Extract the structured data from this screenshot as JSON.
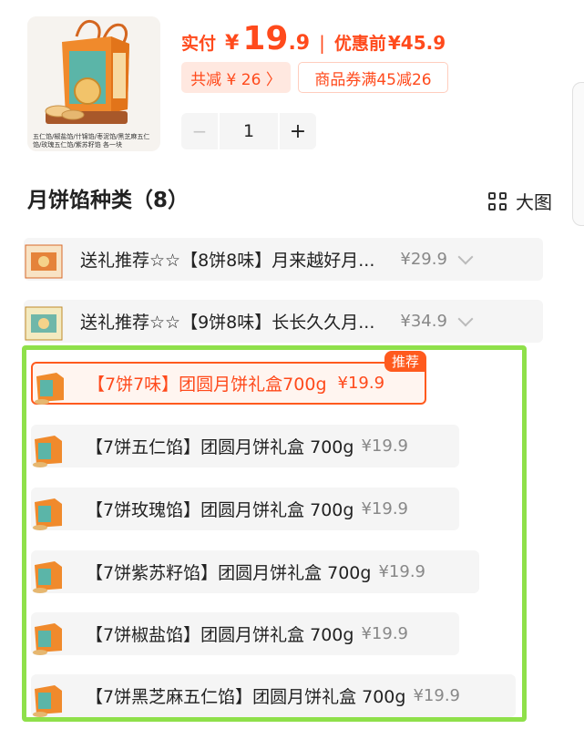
{
  "product": {
    "caption": "五仁馅/椒盐馅/什锦馅/枣泥馅/黑芝麻五仁馅/玫瑰五仁馅/紫苏籽馅 各一块"
  },
  "price": {
    "label": "实付",
    "currency": "¥",
    "int": "19",
    "dec": ".9",
    "separator": "|",
    "original_label": "优惠前",
    "original": "¥45.9"
  },
  "discounts": {
    "total_label": "共减 ¥ 26 〉",
    "coupon_label": "商品券满45减26"
  },
  "stepper": {
    "minus": "−",
    "qty": "1",
    "plus": "+"
  },
  "section": {
    "title": "月饼馅种类（8）",
    "view_label": "大图"
  },
  "options": [
    {
      "text": "送礼推荐☆☆【8饼8味】月来越好月...",
      "price": "¥29.9"
    },
    {
      "text": "送礼推荐☆☆【9饼8味】长长久久月...",
      "price": "¥34.9"
    },
    {
      "text": "【7饼7味】团圆月饼礼盒700g",
      "price": "¥19.9",
      "badge": "推荐"
    },
    {
      "text": "【7饼五仁馅】团圆月饼礼盒 700g",
      "price": "¥19.9"
    },
    {
      "text": "【7饼玫瑰馅】团圆月饼礼盒 700g",
      "price": "¥19.9"
    },
    {
      "text": "【7饼紫苏籽馅】团圆月饼礼盒 700g",
      "price": "¥19.9"
    },
    {
      "text": "【7饼椒盐馅】团圆月饼礼盒 700g",
      "price": "¥19.9"
    },
    {
      "text": "【7饼黑芝麻五仁馅】团圆月饼礼盒 700g",
      "price": "¥19.9"
    }
  ],
  "colors": {
    "accent": "#ff4a1c",
    "highlight_border": "#8fe04a",
    "row_bg": "#f5f5f5"
  }
}
